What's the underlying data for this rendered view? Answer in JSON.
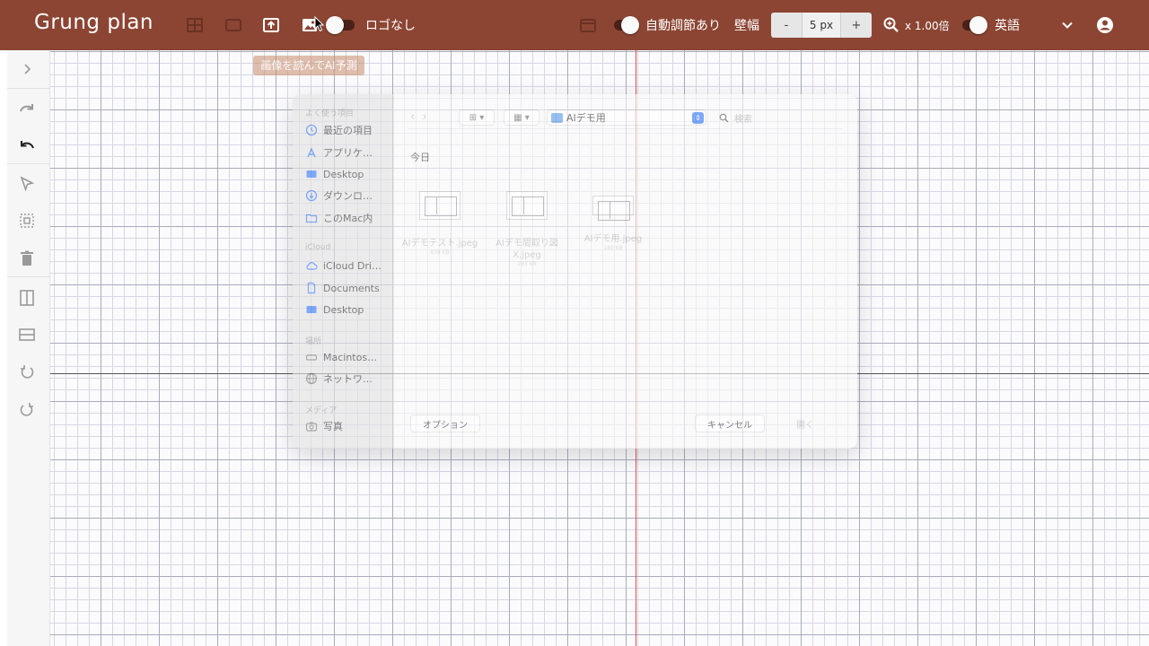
{
  "app": {
    "logo": "Grung plan",
    "brand_color": "#8c4533"
  },
  "toolbar": {
    "logo_toggle_label": "ロゴなし",
    "auto_adjust_label": "自動調節あり",
    "wall_width_label": "壁幅",
    "wall_width_minus": "-",
    "wall_width_value": "5 px",
    "wall_width_plus": "+",
    "zoom_label": "x 1.00倍",
    "language_label": "英語",
    "tooltip": "画像を読んでAI予測"
  },
  "dialog": {
    "sidebar": {
      "favorites_header": "よく使う項目",
      "favorites": [
        "最近の項目",
        "アプリケ…",
        "Desktop",
        "ダウンロ…",
        "このMac内"
      ],
      "icloud_header": "iCloud",
      "icloud": [
        "iCloud Dri…",
        "Documents",
        "Desktop"
      ],
      "locations_header": "場所",
      "locations": [
        "Macintos…",
        "ネットワ…"
      ],
      "media_header": "メディア",
      "media": [
        "写真"
      ]
    },
    "current_folder": "AIデモ用",
    "search_placeholder": "検索",
    "section": "今日",
    "files": [
      {
        "name": "AIデモテスト.jpeg",
        "size": "838 KB"
      },
      {
        "name": "AIデモ間取り図X.jpeg",
        "size": "293 KB"
      },
      {
        "name": "AIデモ用.jpeg",
        "size": "180 KB"
      }
    ],
    "options_label": "オプション",
    "cancel_label": "キャンセル",
    "open_label": "開く"
  }
}
